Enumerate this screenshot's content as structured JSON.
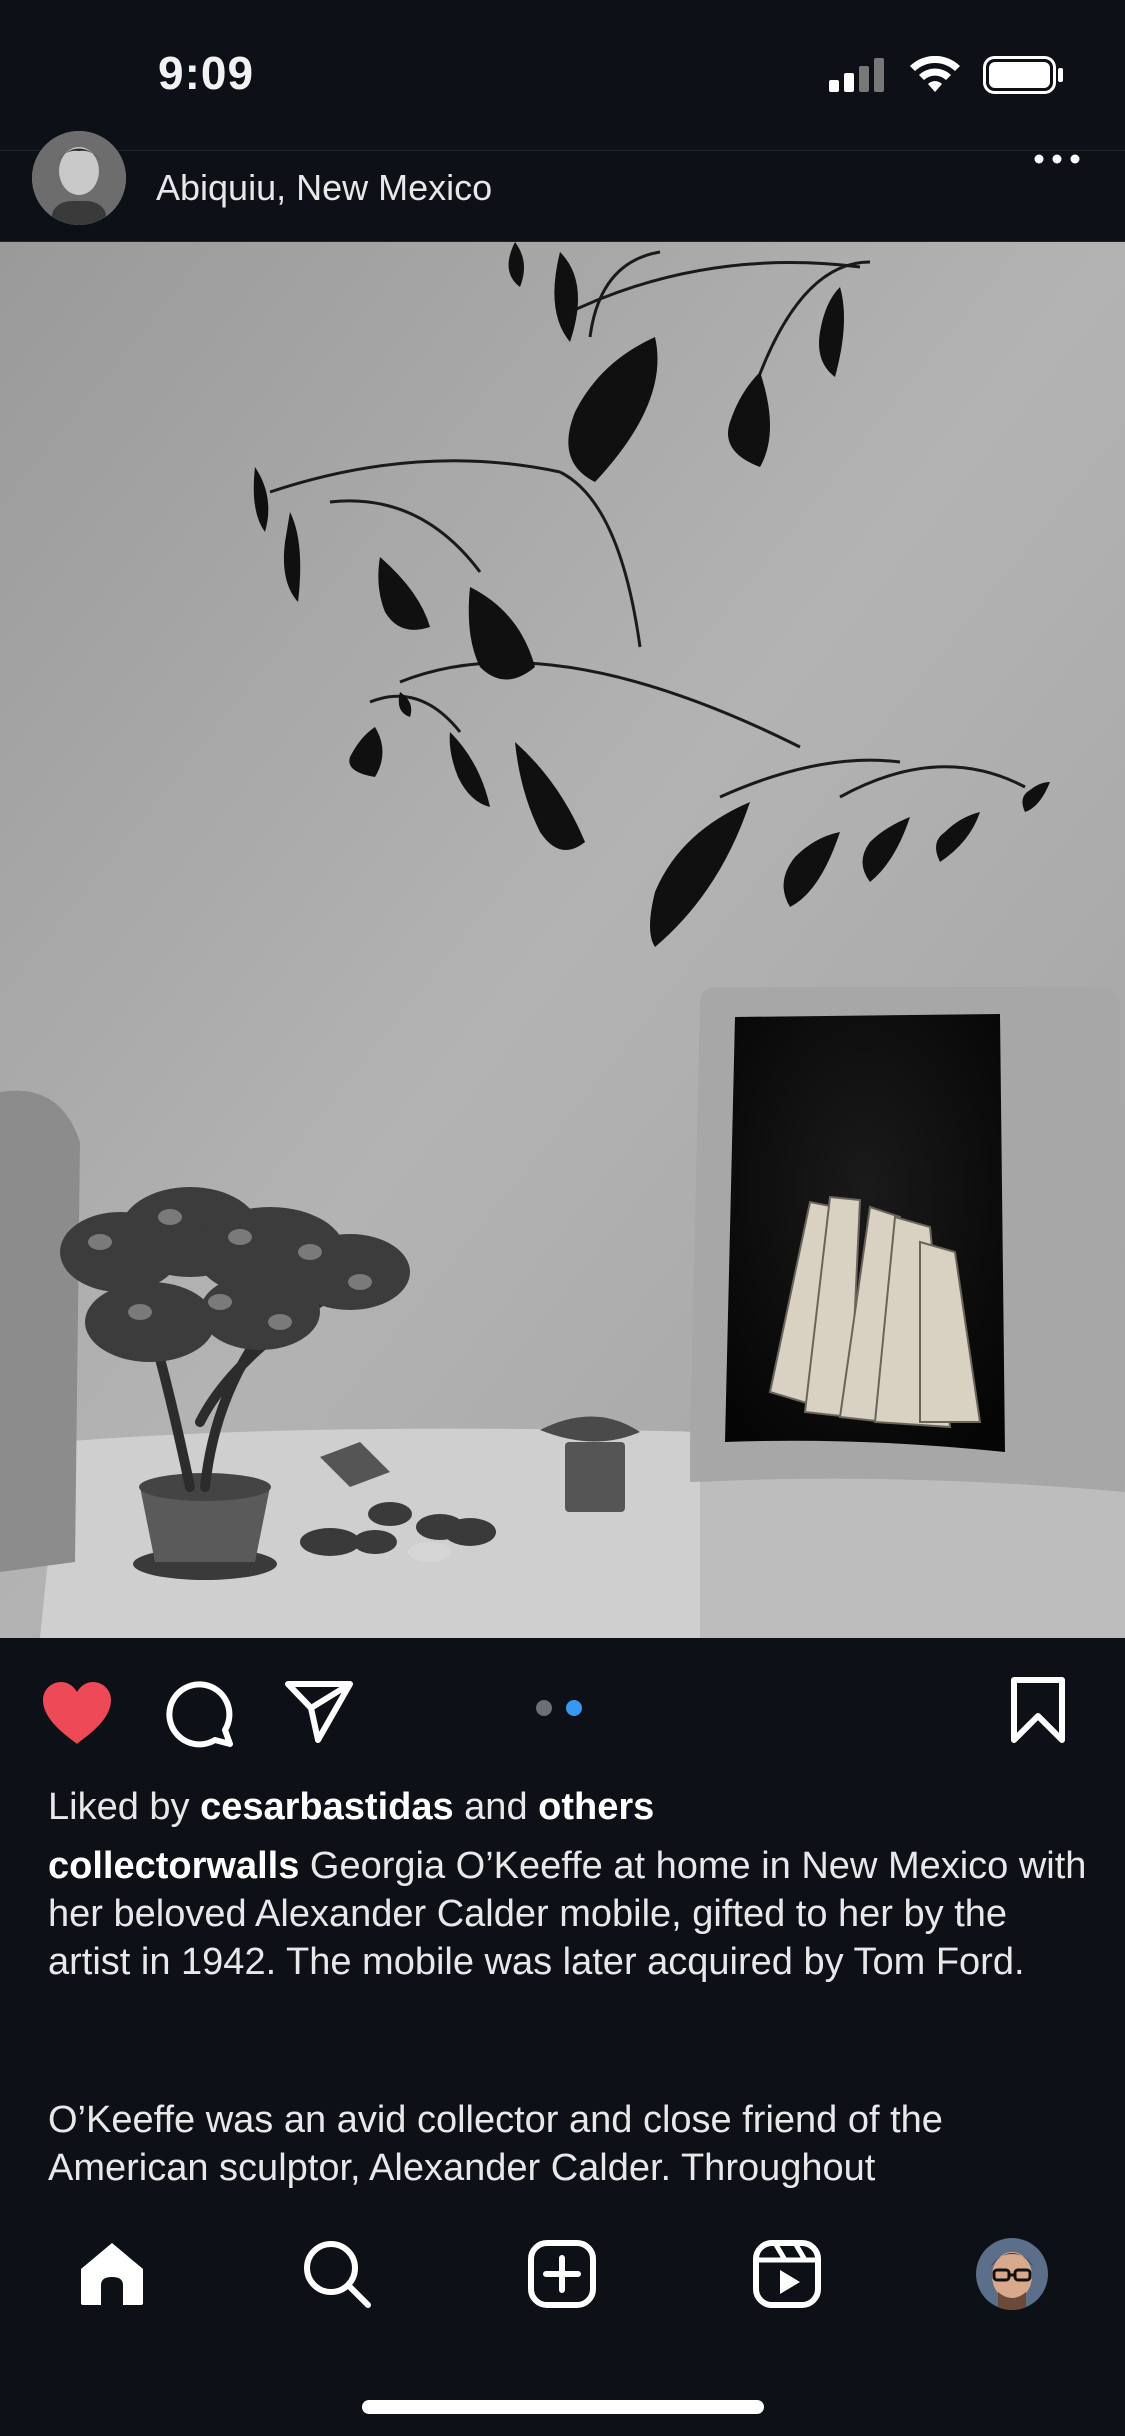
{
  "status": {
    "time": "9:09",
    "signal_icon": "cellular-signal-icon",
    "wifi_icon": "wifi-icon",
    "battery_icon": "battery-icon"
  },
  "post": {
    "location": "Abiquiu, New Mexico",
    "author_avatar_icon": "avatar",
    "more_icon": "more-horizontal-icon",
    "image": {
      "subject": "black and white photograph"
    },
    "actions": {
      "like_icon": "heart-filled-icon",
      "comment_icon": "comment-icon",
      "share_icon": "send-icon",
      "save_icon": "bookmark-icon"
    },
    "carousel": {
      "count": 2,
      "active_index": 1,
      "active_color": "#3897f0",
      "inactive_color": "#6b6f76"
    },
    "likes": {
      "prefix": "Liked by",
      "user": "cesarbastidas",
      "conjunction": "and",
      "others": "others"
    },
    "caption": {
      "username": "collectorwalls",
      "text": "Georgia O’Keeffe at home in New Mexico with her beloved Alexander Calder mobile, gifted to her by the artist in 1942. The mobile was later acquired by Tom Ford.",
      "paragraph2": "O’Keeffe was an avid collector and close friend of the American sculptor, Alexander Calder. Throughout"
    }
  },
  "tabbar": {
    "home_icon": "home-icon",
    "search_icon": "search-icon",
    "create_icon": "create-post-icon",
    "reels_icon": "reels-icon",
    "profile_icon": "profile-avatar"
  },
  "colors": {
    "background": "#0d1117",
    "like_red": "#ed4956",
    "text": "#e8e8e8"
  }
}
